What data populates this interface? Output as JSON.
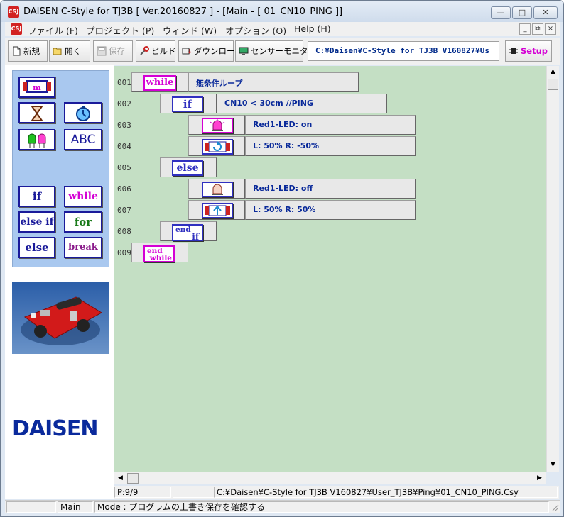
{
  "window": {
    "title": "DAISEN C-Style for TJ3B  [ Ver.20160827 ] - [Main - [ 01_CN10_PING ]]",
    "app_icon": "CSJ"
  },
  "menu": {
    "items": [
      "ファイル (F)",
      "プロジェクト (P)",
      "ウィンド (W)",
      "オプション (O)",
      "Help (H)"
    ]
  },
  "toolbar": {
    "new_label": "新規",
    "open_label": "開く",
    "save_label": "保存",
    "build_label": "ビルド",
    "download_label": "ダウンロード",
    "monitor_label": "センサーモニター",
    "path": "C:¥Daisen¥C-Style for TJ3B V160827¥Us",
    "setup_label": "Setup"
  },
  "palette": {
    "text_label": "ABC",
    "if_label": "if",
    "while_label": "while",
    "elseif_label": "else if",
    "for_label": "for",
    "else_label": "else",
    "break_label": "break"
  },
  "logo": "DAISEN",
  "program": {
    "lines": [
      {
        "num": "001",
        "keyword": "while",
        "code": "無条件ループ"
      },
      {
        "num": "002",
        "keyword": "if",
        "code": "CN10 < 30cm  //PING"
      },
      {
        "num": "003",
        "icon": "led-on-icon",
        "code": "Red1-LED: on"
      },
      {
        "num": "004",
        "icon": "motor-spin-icon",
        "code": "L:  50%  R: -50%"
      },
      {
        "num": "005",
        "keyword": "else",
        "code": ""
      },
      {
        "num": "006",
        "icon": "led-off-icon",
        "code": "Red1-LED: off"
      },
      {
        "num": "007",
        "icon": "motor-forward-icon",
        "code": "L:  50%  R:  50%"
      },
      {
        "num": "008",
        "keyword_top": "end",
        "keyword_bottom": "if"
      },
      {
        "num": "009",
        "keyword_top": "end",
        "keyword_bottom": "while"
      }
    ]
  },
  "status": {
    "position": "P:9/9",
    "file_path": "C:¥Daisen¥C-Style for TJ3B V160827¥User_TJ3B¥Ping¥01_CN10_PING.Csy",
    "module": "Main",
    "mode": "Mode : プログラムの上書き保存を確認する"
  },
  "colors": {
    "program_bg": "#c4dfc4",
    "palette_bg": "#a9c8ef",
    "keyword_blue": "#3030c0",
    "keyword_magenta": "#d400d4",
    "keyword_green": "#1a7a1a",
    "code_text": "#0a2a9a"
  }
}
